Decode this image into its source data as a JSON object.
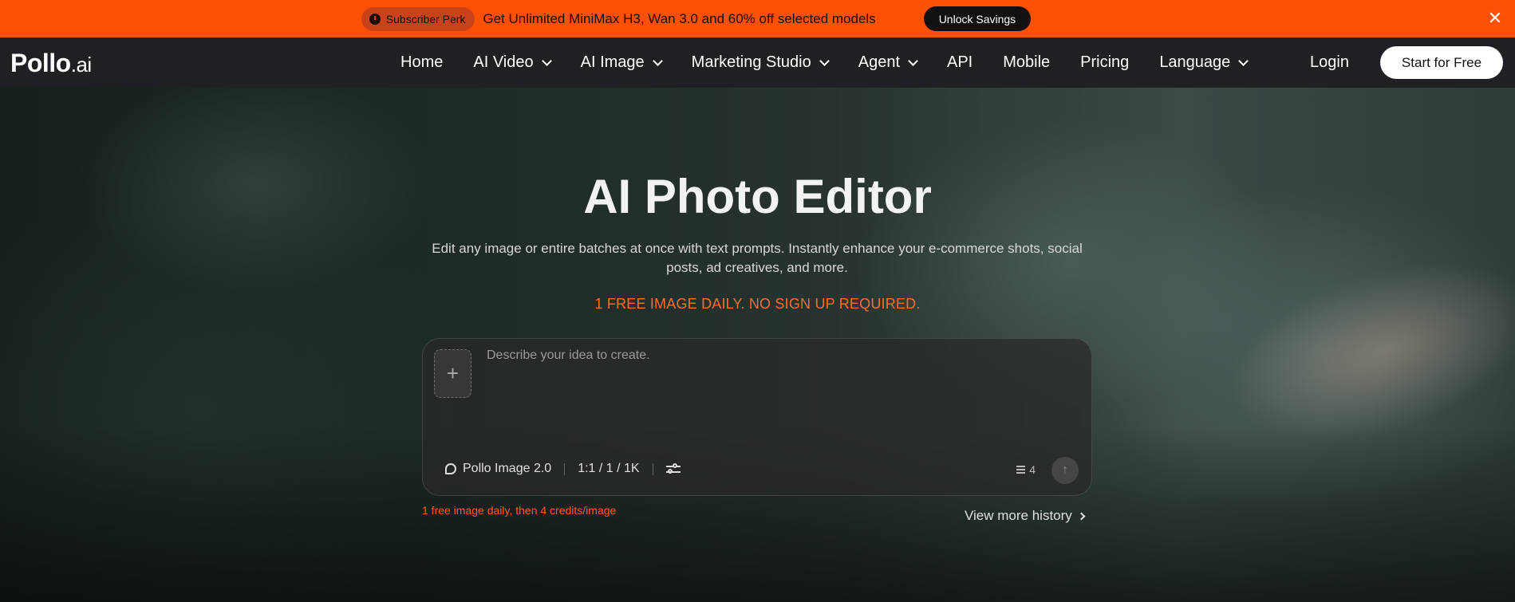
{
  "promo": {
    "badge": "Subscriber Perk",
    "text": "Get Unlimited MiniMax H3, Wan 3.0 and 60% off selected models",
    "cta": "Unlock Savings",
    "close": "✕"
  },
  "nav": {
    "logo_main": "Pollo",
    "logo_suffix": ".ai",
    "items": [
      {
        "label": "Home",
        "dropdown": false
      },
      {
        "label": "AI Video",
        "dropdown": true
      },
      {
        "label": "AI Image",
        "dropdown": true
      },
      {
        "label": "Marketing Studio",
        "dropdown": true
      },
      {
        "label": "Agent",
        "dropdown": true
      },
      {
        "label": "API",
        "dropdown": false
      },
      {
        "label": "Mobile",
        "dropdown": false
      },
      {
        "label": "Pricing",
        "dropdown": false
      },
      {
        "label": "Language",
        "dropdown": true
      }
    ],
    "login": "Login",
    "start": "Start for Free"
  },
  "hero": {
    "title": "AI Photo Editor",
    "subtitle": "Edit any image or entire batches at once with text prompts. Instantly enhance your e-commerce shots, social posts, ad creatives, and more.",
    "free_line": "1 FREE IMAGE DAILY. NO SIGN UP REQUIRED."
  },
  "prompt": {
    "placeholder": "Describe your idea to create.",
    "add": "+",
    "model": "Pollo Image 2.0",
    "settings": "1:1 / 1 / 1K",
    "credits": "4",
    "send": "↑"
  },
  "footer": {
    "hint": "1 free image daily, then 4 credits/image",
    "history": "View more history"
  },
  "colors": {
    "promo_bg": "#ff5106",
    "nav_bg": "#1f2023",
    "accent": "#ff6d2d"
  }
}
